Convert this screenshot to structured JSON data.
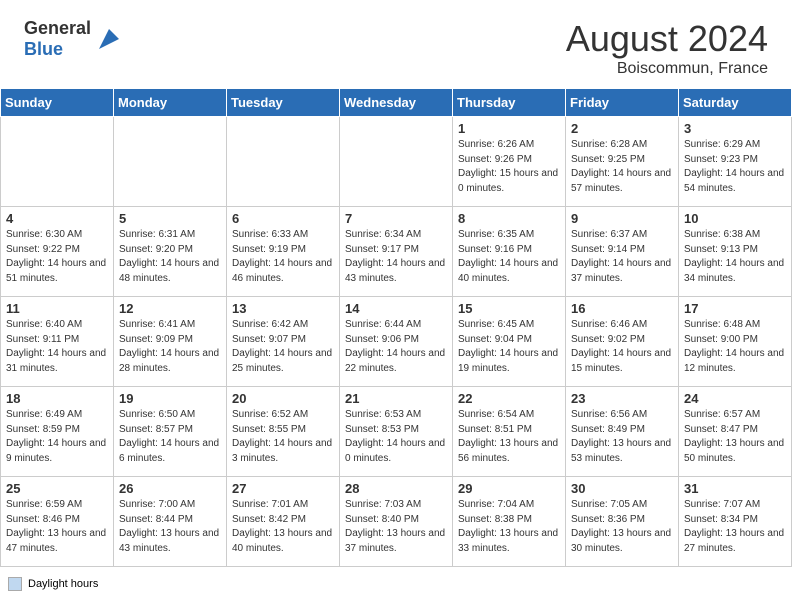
{
  "header": {
    "logo_general": "General",
    "logo_blue": "Blue",
    "month_year": "August 2024",
    "location": "Boiscommun, France"
  },
  "legend": {
    "label": "Daylight hours"
  },
  "weekdays": [
    "Sunday",
    "Monday",
    "Tuesday",
    "Wednesday",
    "Thursday",
    "Friday",
    "Saturday"
  ],
  "weeks": [
    [
      {
        "day": "",
        "info": ""
      },
      {
        "day": "",
        "info": ""
      },
      {
        "day": "",
        "info": ""
      },
      {
        "day": "",
        "info": ""
      },
      {
        "day": "1",
        "info": "Sunrise: 6:26 AM\nSunset: 9:26 PM\nDaylight: 15 hours and 0 minutes."
      },
      {
        "day": "2",
        "info": "Sunrise: 6:28 AM\nSunset: 9:25 PM\nDaylight: 14 hours and 57 minutes."
      },
      {
        "day": "3",
        "info": "Sunrise: 6:29 AM\nSunset: 9:23 PM\nDaylight: 14 hours and 54 minutes."
      }
    ],
    [
      {
        "day": "4",
        "info": "Sunrise: 6:30 AM\nSunset: 9:22 PM\nDaylight: 14 hours and 51 minutes."
      },
      {
        "day": "5",
        "info": "Sunrise: 6:31 AM\nSunset: 9:20 PM\nDaylight: 14 hours and 48 minutes."
      },
      {
        "day": "6",
        "info": "Sunrise: 6:33 AM\nSunset: 9:19 PM\nDaylight: 14 hours and 46 minutes."
      },
      {
        "day": "7",
        "info": "Sunrise: 6:34 AM\nSunset: 9:17 PM\nDaylight: 14 hours and 43 minutes."
      },
      {
        "day": "8",
        "info": "Sunrise: 6:35 AM\nSunset: 9:16 PM\nDaylight: 14 hours and 40 minutes."
      },
      {
        "day": "9",
        "info": "Sunrise: 6:37 AM\nSunset: 9:14 PM\nDaylight: 14 hours and 37 minutes."
      },
      {
        "day": "10",
        "info": "Sunrise: 6:38 AM\nSunset: 9:13 PM\nDaylight: 14 hours and 34 minutes."
      }
    ],
    [
      {
        "day": "11",
        "info": "Sunrise: 6:40 AM\nSunset: 9:11 PM\nDaylight: 14 hours and 31 minutes."
      },
      {
        "day": "12",
        "info": "Sunrise: 6:41 AM\nSunset: 9:09 PM\nDaylight: 14 hours and 28 minutes."
      },
      {
        "day": "13",
        "info": "Sunrise: 6:42 AM\nSunset: 9:07 PM\nDaylight: 14 hours and 25 minutes."
      },
      {
        "day": "14",
        "info": "Sunrise: 6:44 AM\nSunset: 9:06 PM\nDaylight: 14 hours and 22 minutes."
      },
      {
        "day": "15",
        "info": "Sunrise: 6:45 AM\nSunset: 9:04 PM\nDaylight: 14 hours and 19 minutes."
      },
      {
        "day": "16",
        "info": "Sunrise: 6:46 AM\nSunset: 9:02 PM\nDaylight: 14 hours and 15 minutes."
      },
      {
        "day": "17",
        "info": "Sunrise: 6:48 AM\nSunset: 9:00 PM\nDaylight: 14 hours and 12 minutes."
      }
    ],
    [
      {
        "day": "18",
        "info": "Sunrise: 6:49 AM\nSunset: 8:59 PM\nDaylight: 14 hours and 9 minutes."
      },
      {
        "day": "19",
        "info": "Sunrise: 6:50 AM\nSunset: 8:57 PM\nDaylight: 14 hours and 6 minutes."
      },
      {
        "day": "20",
        "info": "Sunrise: 6:52 AM\nSunset: 8:55 PM\nDaylight: 14 hours and 3 minutes."
      },
      {
        "day": "21",
        "info": "Sunrise: 6:53 AM\nSunset: 8:53 PM\nDaylight: 14 hours and 0 minutes."
      },
      {
        "day": "22",
        "info": "Sunrise: 6:54 AM\nSunset: 8:51 PM\nDaylight: 13 hours and 56 minutes."
      },
      {
        "day": "23",
        "info": "Sunrise: 6:56 AM\nSunset: 8:49 PM\nDaylight: 13 hours and 53 minutes."
      },
      {
        "day": "24",
        "info": "Sunrise: 6:57 AM\nSunset: 8:47 PM\nDaylight: 13 hours and 50 minutes."
      }
    ],
    [
      {
        "day": "25",
        "info": "Sunrise: 6:59 AM\nSunset: 8:46 PM\nDaylight: 13 hours and 47 minutes."
      },
      {
        "day": "26",
        "info": "Sunrise: 7:00 AM\nSunset: 8:44 PM\nDaylight: 13 hours and 43 minutes."
      },
      {
        "day": "27",
        "info": "Sunrise: 7:01 AM\nSunset: 8:42 PM\nDaylight: 13 hours and 40 minutes."
      },
      {
        "day": "28",
        "info": "Sunrise: 7:03 AM\nSunset: 8:40 PM\nDaylight: 13 hours and 37 minutes."
      },
      {
        "day": "29",
        "info": "Sunrise: 7:04 AM\nSunset: 8:38 PM\nDaylight: 13 hours and 33 minutes."
      },
      {
        "day": "30",
        "info": "Sunrise: 7:05 AM\nSunset: 8:36 PM\nDaylight: 13 hours and 30 minutes."
      },
      {
        "day": "31",
        "info": "Sunrise: 7:07 AM\nSunset: 8:34 PM\nDaylight: 13 hours and 27 minutes."
      }
    ]
  ]
}
